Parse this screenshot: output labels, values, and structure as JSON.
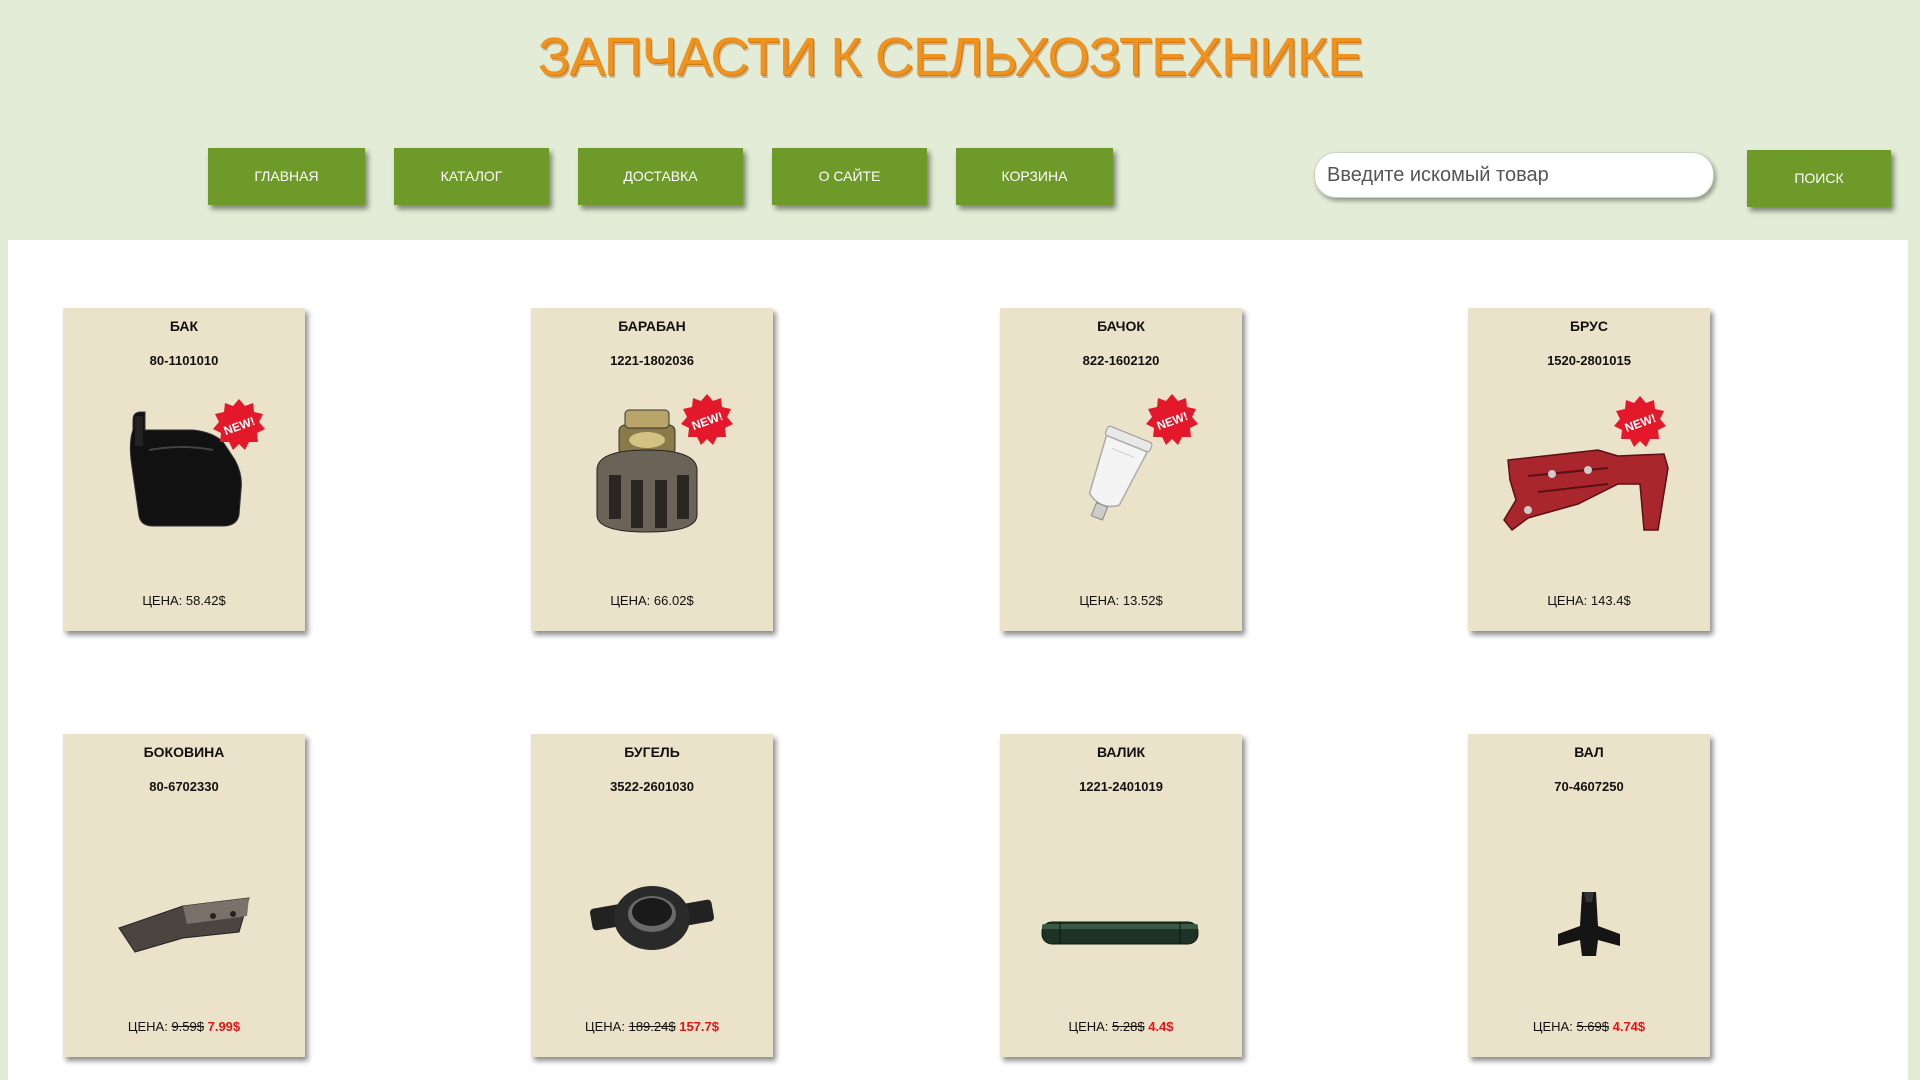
{
  "header": {
    "title": "ЗАПЧАСТИ К СЕЛЬХОЗТЕХНИКЕ"
  },
  "nav": {
    "home": "ГЛАВНАЯ",
    "catalog": "КАТАЛОГ",
    "delivery": "ДОСТАВКА",
    "about": "О САЙТЕ",
    "cart": "КОРЗИНА"
  },
  "search": {
    "placeholder": "Введите искомый товар",
    "button_label": "ПОИСК"
  },
  "colors": {
    "header_bg": "#e2ecd6",
    "title": "#f0921e",
    "button": "#6e9a2a",
    "card_bg": "#ebe3c9",
    "sale_price": "#e01515",
    "new_badge": "#e3182a"
  },
  "price_prefix": "ЦЕНА:",
  "new_badge_text": "NEW!",
  "products": [
    {
      "name": "БАК",
      "code": "80-1101010",
      "price": "58.42$",
      "is_new": true,
      "image_icon": "fuel-tank-icon"
    },
    {
      "name": "БАРАБАН",
      "code": "1221-1802036",
      "price": "66.02$",
      "is_new": true,
      "image_icon": "drum-icon"
    },
    {
      "name": "БАЧОК",
      "code": "822-1602120",
      "price": "13.52$",
      "is_new": true,
      "image_icon": "reservoir-icon"
    },
    {
      "name": "БРУС",
      "code": "1520-2801015",
      "price": "143.4$",
      "is_new": true,
      "image_icon": "frame-beam-icon"
    },
    {
      "name": "БОКОВИНА",
      "code": "80-6702330",
      "old_price": "9.59$",
      "sale_price": "7.99$",
      "is_new": false,
      "image_icon": "side-panel-icon"
    },
    {
      "name": "БУГЕЛЬ",
      "code": "3522-2601030",
      "old_price": "189.24$",
      "sale_price": "157.7$",
      "is_new": false,
      "image_icon": "bracket-icon"
    },
    {
      "name": "ВАЛИК",
      "code": "1221-2401019",
      "old_price": "5.28$",
      "sale_price": "4.4$",
      "is_new": false,
      "image_icon": "roller-shaft-icon"
    },
    {
      "name": "ВАЛ",
      "code": "70-4607250",
      "old_price": "5.69$",
      "sale_price": "4.74$",
      "is_new": false,
      "image_icon": "shaft-icon"
    }
  ]
}
